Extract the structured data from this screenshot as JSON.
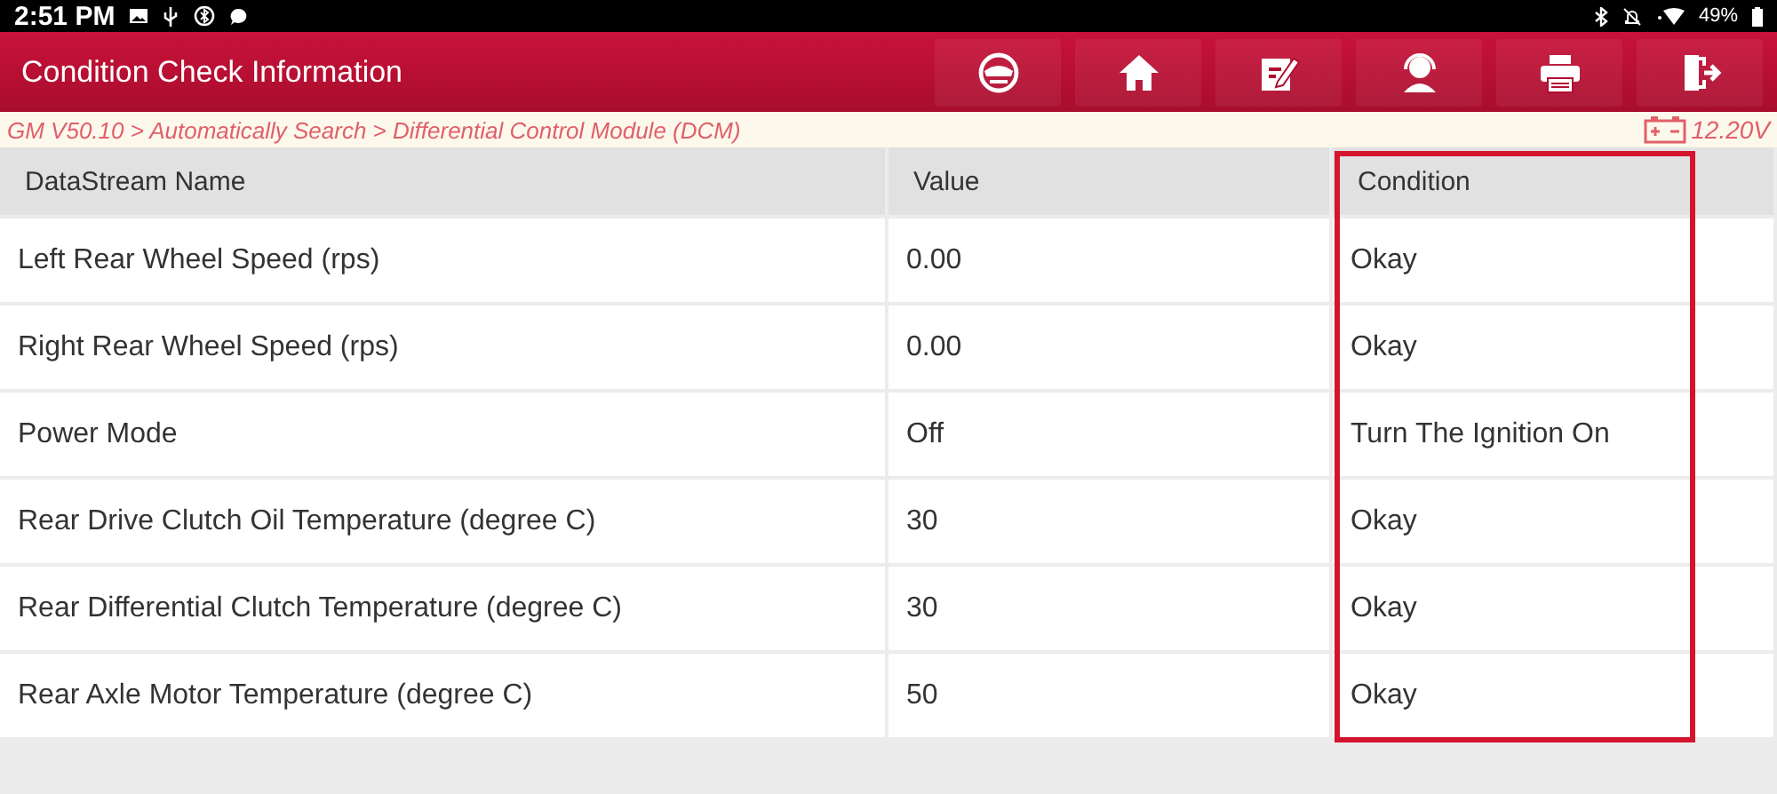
{
  "status_bar": {
    "time": "2:51 PM",
    "battery": "49%"
  },
  "header": {
    "title": "Condition Check Information"
  },
  "breadcrumb": {
    "path": "GM V50.10 > Automatically Search > Differential Control Module (DCM)",
    "voltage": "12.20V"
  },
  "table": {
    "columns": [
      {
        "label": "DataStream Name",
        "highlighted": false
      },
      {
        "label": "Value",
        "highlighted": false
      },
      {
        "label": "Condition",
        "highlighted": true
      }
    ],
    "rows": [
      {
        "cells": [
          "Left Rear Wheel Speed (rps)",
          "0.00",
          "Okay"
        ]
      },
      {
        "cells": [
          "Right Rear Wheel Speed (rps)",
          "0.00",
          "Okay"
        ]
      },
      {
        "cells": [
          "Power Mode",
          "Off",
          "Turn The Ignition On"
        ]
      },
      {
        "cells": [
          "Rear Drive Clutch Oil Temperature (degree C)",
          "30",
          "Okay"
        ]
      },
      {
        "cells": [
          "Rear Differential Clutch Temperature (degree C)",
          "30",
          "Okay"
        ]
      },
      {
        "cells": [
          "Rear Axle Motor Temperature (degree C)",
          "50",
          "Okay"
        ]
      }
    ]
  }
}
